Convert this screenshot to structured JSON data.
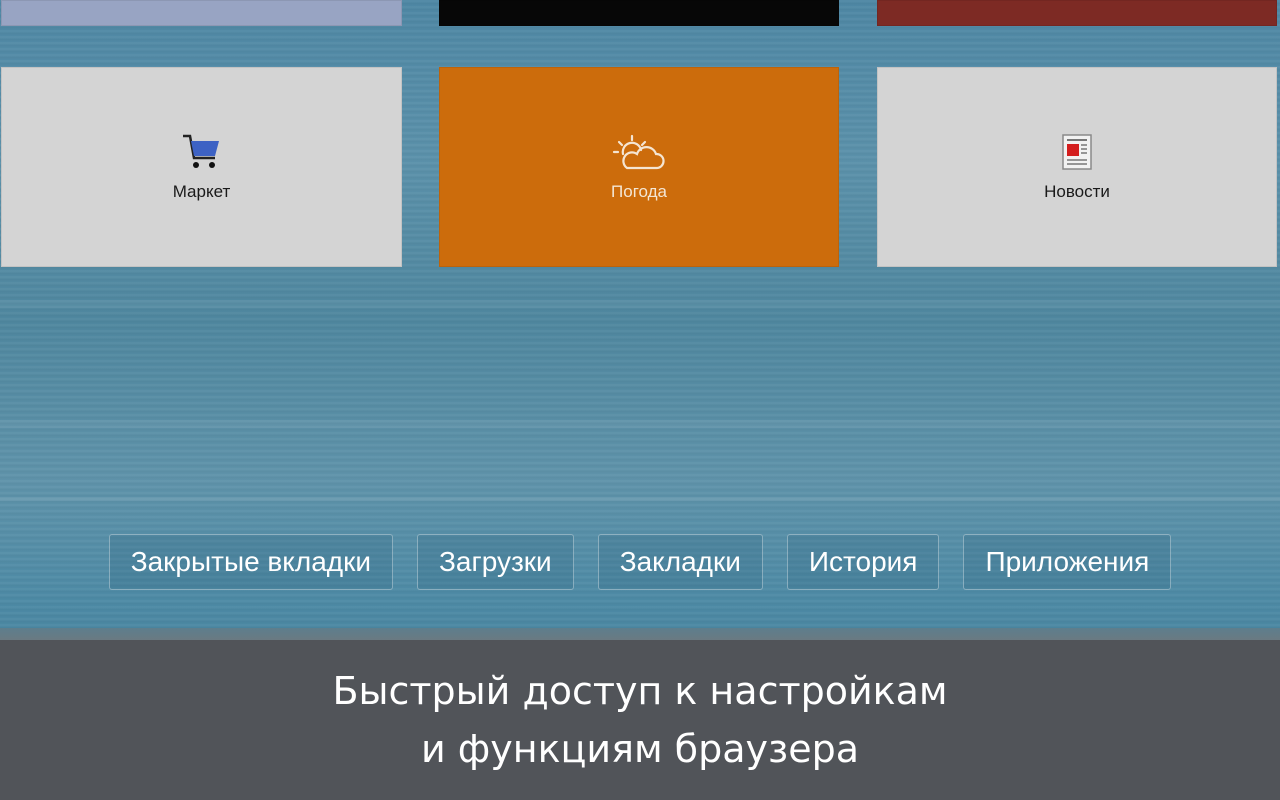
{
  "colors": {
    "tile_top_1": "#98a4c3",
    "tile_top_2": "#070707",
    "tile_top_3": "#7d2a24",
    "tile_light": "#d4d4d4",
    "tile_orange": "#cc6c0c",
    "caption_bg": "#515459"
  },
  "tiles": [
    {
      "label": "Маркет",
      "icon": "shopping-cart-icon"
    },
    {
      "label": "Погода",
      "icon": "weather-sun-cloud-icon"
    },
    {
      "label": "Новости",
      "icon": "newspaper-icon"
    }
  ],
  "quick_links": [
    {
      "label": "Закрытые вкладки"
    },
    {
      "label": "Загрузки"
    },
    {
      "label": "Закладки"
    },
    {
      "label": "История"
    },
    {
      "label": "Приложения"
    }
  ],
  "caption": {
    "line1": "Быстрый доступ к настройкам",
    "line2": "и функциям браузера"
  }
}
